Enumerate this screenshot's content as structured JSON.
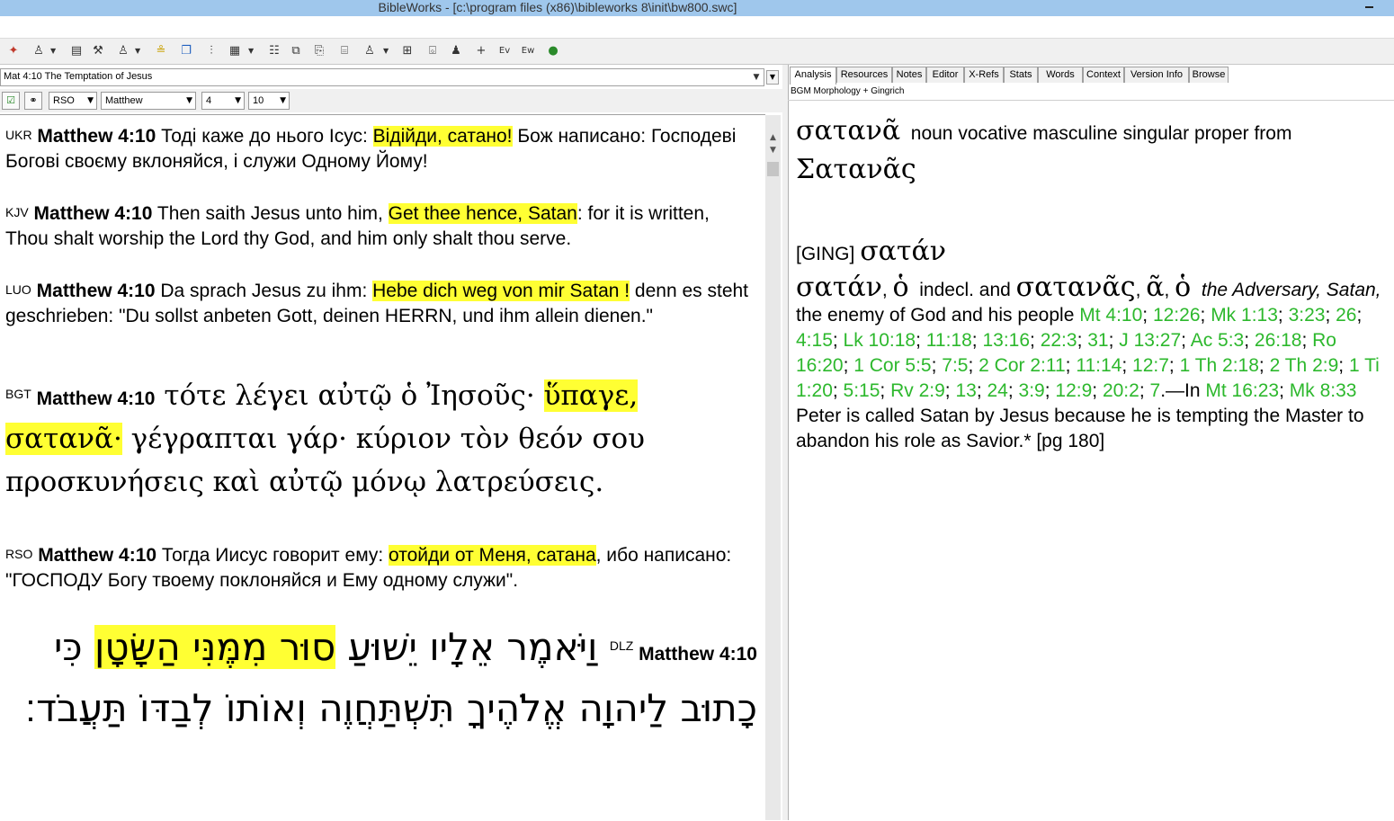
{
  "window": {
    "title": "BibleWorks - [c:\\program files (x86)\\bibleworks 8\\init\\bw800.swc]"
  },
  "toolbar": {
    "icons": [
      "crosshair-icon",
      "person-icon",
      "card-icon",
      "tools-icon",
      "person2-icon",
      "highlight-icon",
      "windows-icon",
      "columns-icon",
      "grid-icon",
      "list-icon",
      "copy-icon",
      "open-icon",
      "print-icon",
      "person3-icon",
      "group-icon",
      "ruler-icon",
      "user-icon",
      "plus-icon",
      "ev-icon",
      "ew-icon",
      "globe-icon"
    ]
  },
  "reference_bar": {
    "text": "Mat 4:10 The Temptation of Jesus"
  },
  "selectors": {
    "version": "RSO",
    "book": "Matthew",
    "chapter": "4",
    "verse": "10"
  },
  "verses": [
    {
      "version": "UKR",
      "ref": "Matthew 4:10",
      "pre": " Тоді каже до нього Ісус: ",
      "hl": "Відійди, сатано!",
      "post": " Бож написано: Господеві Богові своєму вклоняйся, і служи Одному Йому!"
    },
    {
      "version": "KJV",
      "ref": "Matthew 4:10",
      "pre": " Then saith Jesus unto him, ",
      "hl": "Get thee hence, Satan",
      "post": ": for it is written, Thou shalt worship the Lord thy God, and him only shalt thou serve."
    },
    {
      "version": "LUO",
      "ref": "Matthew 4:10",
      "pre": " Da sprach Jesus zu ihm: ",
      "hl": "Hebe dich weg von mir Satan !",
      "post": " denn es steht geschrieben: \"Du sollst anbeten Gott, deinen HERRN, und ihm allein dienen.\""
    },
    {
      "version": "BGT",
      "ref": "Matthew 4:10",
      "pre": " τότε λέγει αὐτῷ ὁ Ἰησοῦς· ",
      "hl": "ὕπαγε, σατανᾶ·",
      "post": " γέγραπται γάρ· κύριον τὸν θεόν σου προσκυνήσεις καὶ αὐτῷ μόνῳ λατρεύσεις."
    },
    {
      "version": "RSO",
      "ref": "Matthew 4:10",
      "pre": " Тогда Иисус говорит ему: ",
      "hl": "отойди от Меня, сатана",
      "post": ", ибо написано: \"ГОСПОДУ Богу твоему поклоняйся и Ему одному служи\"."
    },
    {
      "version": "DLZ",
      "ref": "Matthew 4:10",
      "pre": " וַיֹּאמֶר אֵלָיו יֵשׁוּעַ ",
      "hl": "סוּר מִמֶּנִּי הַשָּׂטָן",
      "post": " כִּי כָתוּב לַיהוָה אֱלֹהֶיךָ תִּשְׁתַּחֲוֶה וְאוֹתוֹ לְבַדּוֹ תַּעֲבֹד׃"
    }
  ],
  "tabs": [
    "Analysis",
    "Resources",
    "Notes",
    "Editor",
    "X-Refs",
    "Stats",
    "Words",
    "Context",
    "Version Info",
    "Browse"
  ],
  "analysis": {
    "source": "BGM Morphology + Gingrich",
    "word": "σατανᾶ",
    "parse": "noun vocative masculine singular proper from",
    "lemma": "Σατανᾶς",
    "ging_tag": "[GING]",
    "ging_word": "σατάν",
    "entry_head1": "σατάν",
    "entry_art1": "ὁ",
    "entry_indecl": "indecl. and",
    "entry_head2": "σατανᾶς",
    "entry_art2a": "ᾶ",
    "entry_art2b": "ὁ",
    "def_italic": "the Adversary, Satan,",
    "def_text": "the enemy of God and his people",
    "refs1": [
      "Mt 4:10",
      "12:26",
      "Mk 1:13",
      "3:23",
      "26",
      "4:15",
      "Lk 10:18",
      "11:18",
      "13:16",
      "22:3",
      "31",
      "J 13:27",
      "Ac 5:3",
      "26:18",
      "Ro 16:20",
      "1 Cor 5:5",
      "7:5",
      "2 Cor 2:11",
      "11:14",
      "12:7",
      "1 Th 2:18",
      "2 Th 2:9",
      "1 Ti 1:20",
      "5:15",
      "Rv 2:9",
      "13",
      "24",
      "3:9",
      "12:9",
      "20:2",
      "7"
    ],
    "dash_in": ".—In",
    "refs2": [
      "Mt 16:23",
      "Mk 8:33"
    ],
    "closing": "Peter is called Satan by Jesus because he is tempting the Master to abandon his role as Savior.* [pg 180]"
  }
}
